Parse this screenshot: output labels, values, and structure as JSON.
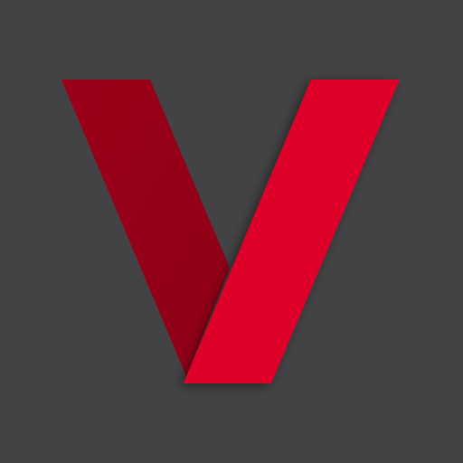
{
  "app_icon": {
    "icon_name": "v-logo-icon",
    "colors": {
      "background": "#434345",
      "left_stroke": "#9B0019",
      "right_stroke": "#DF002A",
      "fold_shadow": "#000000"
    }
  }
}
